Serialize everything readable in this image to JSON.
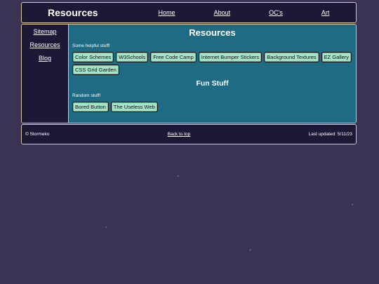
{
  "header": {
    "title": "Resources",
    "nav": [
      "Home",
      "About",
      "OC's",
      "Art"
    ]
  },
  "sidebar": {
    "items": [
      "Sitemap",
      "Resources",
      "Blog"
    ]
  },
  "main": {
    "heading": "Resources",
    "helpful_note": "Some helpful stuff!",
    "helpful_links": [
      "Color Schemes",
      "W3Schools",
      "Free Code Camp",
      "Internet Bumper Stickers",
      "Background Textures",
      "EZ Gallery",
      "CSS Grid Garden"
    ],
    "fun_heading": "Fun Stuff",
    "random_note": "Random stuff!",
    "fun_links": [
      "Bored Button",
      "The Useless Web"
    ]
  },
  "footer": {
    "copyright": "© Stormeko",
    "back_to_top": "Back to top",
    "updated": "Last updated: 5/11/23"
  },
  "colors": {
    "background": "#3a3354",
    "panel": "#1d1835",
    "main": "#1e6b83",
    "border": "#d9c7a3",
    "button": "#a7e3c8"
  }
}
